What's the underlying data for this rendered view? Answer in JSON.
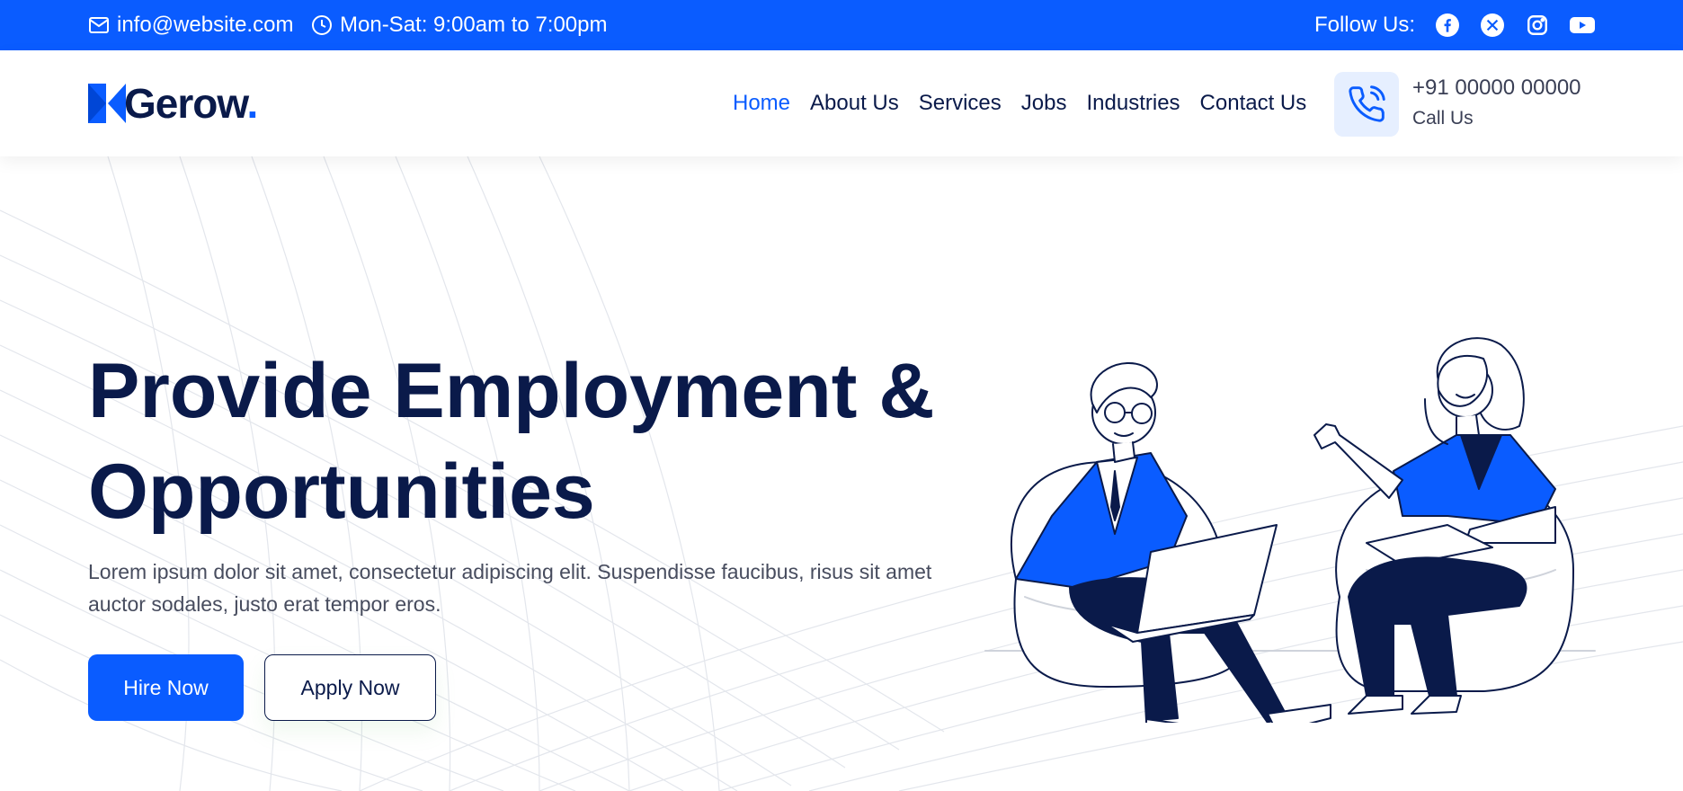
{
  "topbar": {
    "email": "info@website.com",
    "hours": "Mon-Sat: 9:00am to 7:00pm",
    "follow_label": "Follow Us:",
    "social_icons": [
      "facebook-icon",
      "x-icon",
      "instagram-icon",
      "youtube-icon"
    ]
  },
  "header": {
    "logo_text": "Gerow",
    "logo_dot": ".",
    "nav": [
      {
        "label": "Home",
        "active": true
      },
      {
        "label": "About Us"
      },
      {
        "label": "Services"
      },
      {
        "label": "Jobs"
      },
      {
        "label": "Industries"
      },
      {
        "label": "Contact Us"
      }
    ],
    "phone": "+91 00000 00000",
    "phone_label": "Call Us"
  },
  "hero": {
    "headline_line1": "Provide Employment &",
    "headline_line2": "Opportunities",
    "description": "Lorem ipsum dolor sit amet, consectetur adipiscing elit. Suspendisse faucibus, risus sit amet auctor sodales, justo erat tempor eros.",
    "primary_button": "Hire Now",
    "secondary_button": "Apply Now"
  },
  "colors": {
    "brand_blue": "#0a5cff",
    "navy": "#0a1a4a",
    "light_blue_bg": "#e6efff"
  }
}
